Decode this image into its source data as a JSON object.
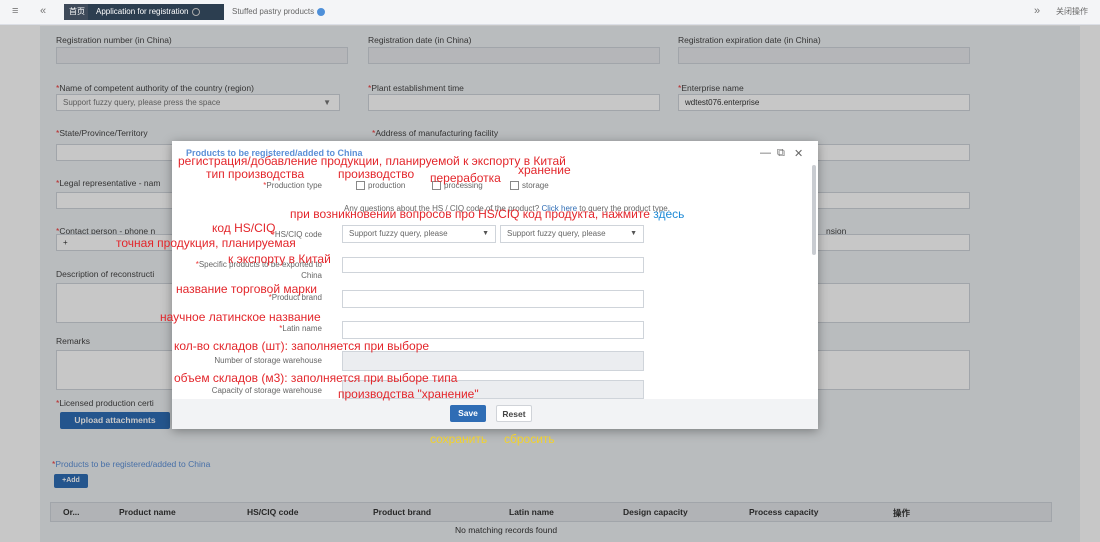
{
  "topbar": {
    "menu_icon": "≡",
    "back_icon": "«",
    "home_tab": "首页",
    "tab_active": "Application for registration",
    "tab_inactive": "Stuffed pastry products",
    "forward_icon": "»",
    "right_label": "关闭操作"
  },
  "form": {
    "reg_number_label": "Registration number (in China)",
    "reg_date_label": "Registration date (in China)",
    "reg_exp_label": "Registration expiration date (in China)",
    "authority_label": "Name of competent authority of the country (region)",
    "authority_placeholder": "Support fuzzy query, please press the space",
    "plant_time_label": "Plant establishment time",
    "enterprise_label": "Enterprise name",
    "enterprise_value": "wdtest076.enterprise",
    "state_label": "State/Province/Territory",
    "address_label": "Address of manufacturing facility",
    "legal_rep_label": "Legal representative - nam",
    "contact_label": "Contact person - phone n",
    "contact_prefix": "+",
    "extension_label": "nsion",
    "description_label": "Description of reconstructi",
    "remarks_label": "Remarks",
    "licensed_label": "Licensed production certi",
    "upload_button": "Upload attachments",
    "products_section_label": "Products to be registered/added to China",
    "add_button": "+Add",
    "table_columns": [
      "Or...",
      "Product name",
      "HS/CIQ code",
      "Product brand",
      "Latin name",
      "Design capacity",
      "Process capacity",
      "操作"
    ],
    "no_records": "No matching records found"
  },
  "modal": {
    "title": "Products to be registered/added to China",
    "minimize_icon": "—",
    "maximize_icon": "⧉",
    "close_icon": "✕",
    "production_type_label": "Production type",
    "options": [
      "production",
      "processing",
      "storage"
    ],
    "hs_question_prefix": "Any questions about the HS / CIQ code of the product? ",
    "hs_question_link": "Click here",
    "hs_question_suffix": " to query the product type.",
    "hs_code_label": "HS/CIQ code",
    "hs_select1_placeholder": "Support fuzzy query, please",
    "hs_select2_placeholder": "Support fuzzy query, please",
    "specific_label_line1": "Specific products to be exported to",
    "specific_label_line2": "China",
    "brand_label": "Product brand",
    "latin_label": "Latin name",
    "storage_count_label": "Number of storage warehouse",
    "storage_capacity_label": "Capacity of storage warehouse",
    "save_button": "Save",
    "reset_button": "Reset"
  },
  "annotations": {
    "title": "регистрация/добавление продукции, планируемой к экспорту в Китай",
    "production_type": "тип производства",
    "production": "производство",
    "processing": "переработка",
    "storage": "хранение",
    "hs_question": "при возникновении вопросов про HS/CIQ код продукта, нажмите ",
    "hs_question_link": "здесь",
    "hs_code": "код HS/CIQ",
    "specific_line1": "точная продукция, планируемая",
    "specific_line2": "к экспорту в Китай",
    "brand": "название торговой марки",
    "latin": "научное латинское название",
    "storage_count": "кол-во складов (шт): заполняется при выборе",
    "storage_capacity_line1": "объем складов (м3): заполняется при выборе типа",
    "storage_capacity_line2": "производства \"хранение\"",
    "save": "сохранить",
    "reset": "сбросить"
  }
}
